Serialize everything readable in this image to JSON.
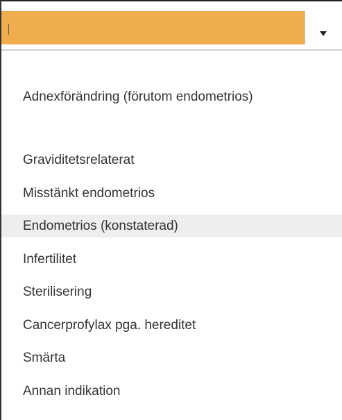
{
  "select": {
    "value": "",
    "dropdown_icon": "triangle-down-icon"
  },
  "options": [
    {
      "label": "Adnexförändring (förutom endometrios)",
      "selected": false
    },
    {
      "label": "Graviditetsrelaterat",
      "selected": false
    },
    {
      "label": "Misstänkt endometrios",
      "selected": false
    },
    {
      "label": "Endometrios (konstaterad)",
      "selected": true
    },
    {
      "label": "Infertilitet",
      "selected": false
    },
    {
      "label": "Sterilisering",
      "selected": false
    },
    {
      "label": "Cancerprofylax pga. hereditet",
      "selected": false
    },
    {
      "label": "Smärta",
      "selected": false
    },
    {
      "label": "Annan indikation",
      "selected": false
    }
  ],
  "colors": {
    "input_background": "#f0ad4e",
    "highlight_background": "#eeeeee",
    "text": "#333333"
  }
}
